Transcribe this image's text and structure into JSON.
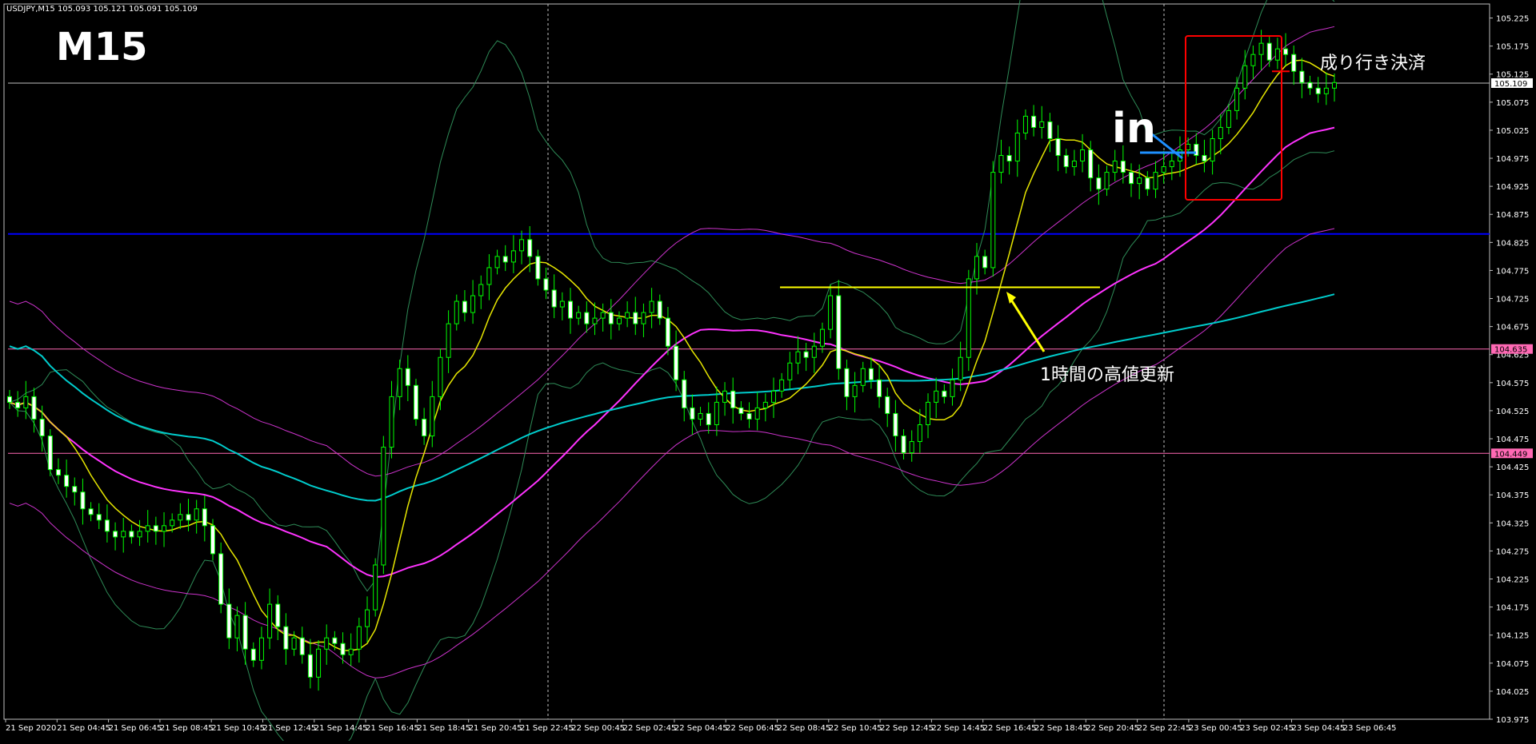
{
  "window": {
    "header": "USDJPY,M15  105.093 105.121 105.091 105.109"
  },
  "annotations": {
    "timeframe": "M15",
    "entry_label": "in",
    "exit_label": "成り行き決済",
    "breakout_label": "1時間の高値更新"
  },
  "chart_data": {
    "type": "candlestick",
    "symbol": "USDJPY",
    "timeframe": "M15",
    "ohlc_current": {
      "open": 105.093,
      "high": 105.121,
      "low": 105.091,
      "close": 105.109
    },
    "ylim": [
      103.975,
      105.25
    ],
    "y_ticks": [
      "105.225",
      "105.175",
      "105.125",
      "105.075",
      "105.025",
      "104.975",
      "104.925",
      "104.875",
      "104.825",
      "104.775",
      "104.725",
      "104.675",
      "104.625",
      "104.575",
      "104.525",
      "104.475",
      "104.425",
      "104.375",
      "104.325",
      "104.275",
      "104.225",
      "104.175",
      "104.125",
      "104.075",
      "104.025",
      "103.975"
    ],
    "x_labels": [
      "21 Sep 2020",
      "21 Sep 04:45",
      "21 Sep 06:45",
      "21 Sep 08:45",
      "21 Sep 10:45",
      "21 Sep 12:45",
      "21 Sep 14:45",
      "21 Sep 16:45",
      "21 Sep 18:45",
      "21 Sep 20:45",
      "21 Sep 22:45",
      "22 Sep 00:45",
      "22 Sep 02:45",
      "22 Sep 04:45",
      "22 Sep 06:45",
      "22 Sep 08:45",
      "22 Sep 10:45",
      "22 Sep 12:45",
      "22 Sep 14:45",
      "22 Sep 16:45",
      "22 Sep 18:45",
      "22 Sep 20:45",
      "22 Sep 22:45",
      "23 Sep 00:45",
      "23 Sep 02:45",
      "23 Sep 04:45",
      "23 Sep 06:45"
    ],
    "price_labels": [
      {
        "value": 105.109,
        "text": "105.109"
      },
      {
        "value": 104.635,
        "text": "104.635"
      },
      {
        "value": 104.449,
        "text": "104.449"
      }
    ],
    "horizontal_lines": [
      {
        "value": 104.84,
        "color": "#0000ff"
      },
      {
        "value": 104.635,
        "color": "#ff69b4"
      },
      {
        "value": 104.449,
        "color": "#ff69b4"
      },
      {
        "value": 105.109,
        "color": "#c0c0c0"
      }
    ],
    "breakout_level": 104.745,
    "entry_level": 104.985,
    "exit_level": 105.13,
    "closes": [
      104.54,
      104.53,
      104.55,
      104.51,
      104.48,
      104.42,
      104.41,
      104.39,
      104.38,
      104.35,
      104.34,
      104.33,
      104.31,
      104.3,
      104.31,
      104.3,
      104.31,
      104.32,
      104.31,
      104.32,
      104.33,
      104.34,
      104.33,
      104.35,
      104.32,
      104.27,
      104.18,
      104.12,
      104.16,
      104.1,
      104.08,
      104.12,
      104.18,
      104.14,
      104.1,
      104.12,
      104.09,
      104.05,
      104.1,
      104.12,
      104.11,
      104.09,
      104.1,
      104.14,
      104.17,
      104.25,
      104.46,
      104.55,
      104.6,
      104.57,
      104.51,
      104.48,
      104.55,
      104.62,
      104.68,
      104.72,
      104.7,
      104.73,
      104.75,
      104.78,
      104.8,
      104.79,
      104.81,
      104.83,
      104.8,
      104.76,
      104.74,
      104.71,
      104.72,
      104.69,
      104.7,
      104.68,
      104.69,
      104.7,
      104.68,
      104.69,
      104.7,
      104.68,
      104.7,
      104.72,
      104.69,
      104.64,
      104.58,
      104.53,
      104.51,
      104.52,
      104.5,
      104.54,
      104.56,
      104.53,
      104.52,
      104.51,
      104.53,
      104.54,
      104.56,
      104.58,
      104.61,
      104.63,
      104.62,
      104.64,
      104.67,
      104.73,
      104.6,
      104.55,
      104.57,
      104.6,
      104.58,
      104.55,
      104.52,
      104.48,
      104.45,
      104.47,
      104.5,
      104.54,
      104.56,
      104.55,
      104.58,
      104.62,
      104.76,
      104.8,
      104.78,
      104.95,
      104.98,
      104.97,
      105.02,
      105.05,
      105.03,
      105.04,
      105.01,
      104.98,
      104.96,
      104.97,
      104.99,
      104.94,
      104.92,
      104.95,
      104.97,
      104.95,
      104.93,
      104.94,
      104.92,
      104.95,
      104.96,
      104.97,
      104.99,
      105.0,
      104.98,
      104.97,
      105.01,
      105.03,
      105.06,
      105.1,
      105.14,
      105.16,
      105.18,
      105.15,
      105.17,
      105.16,
      105.13,
      105.11,
      105.1,
      105.09,
      105.1,
      105.11
    ]
  }
}
